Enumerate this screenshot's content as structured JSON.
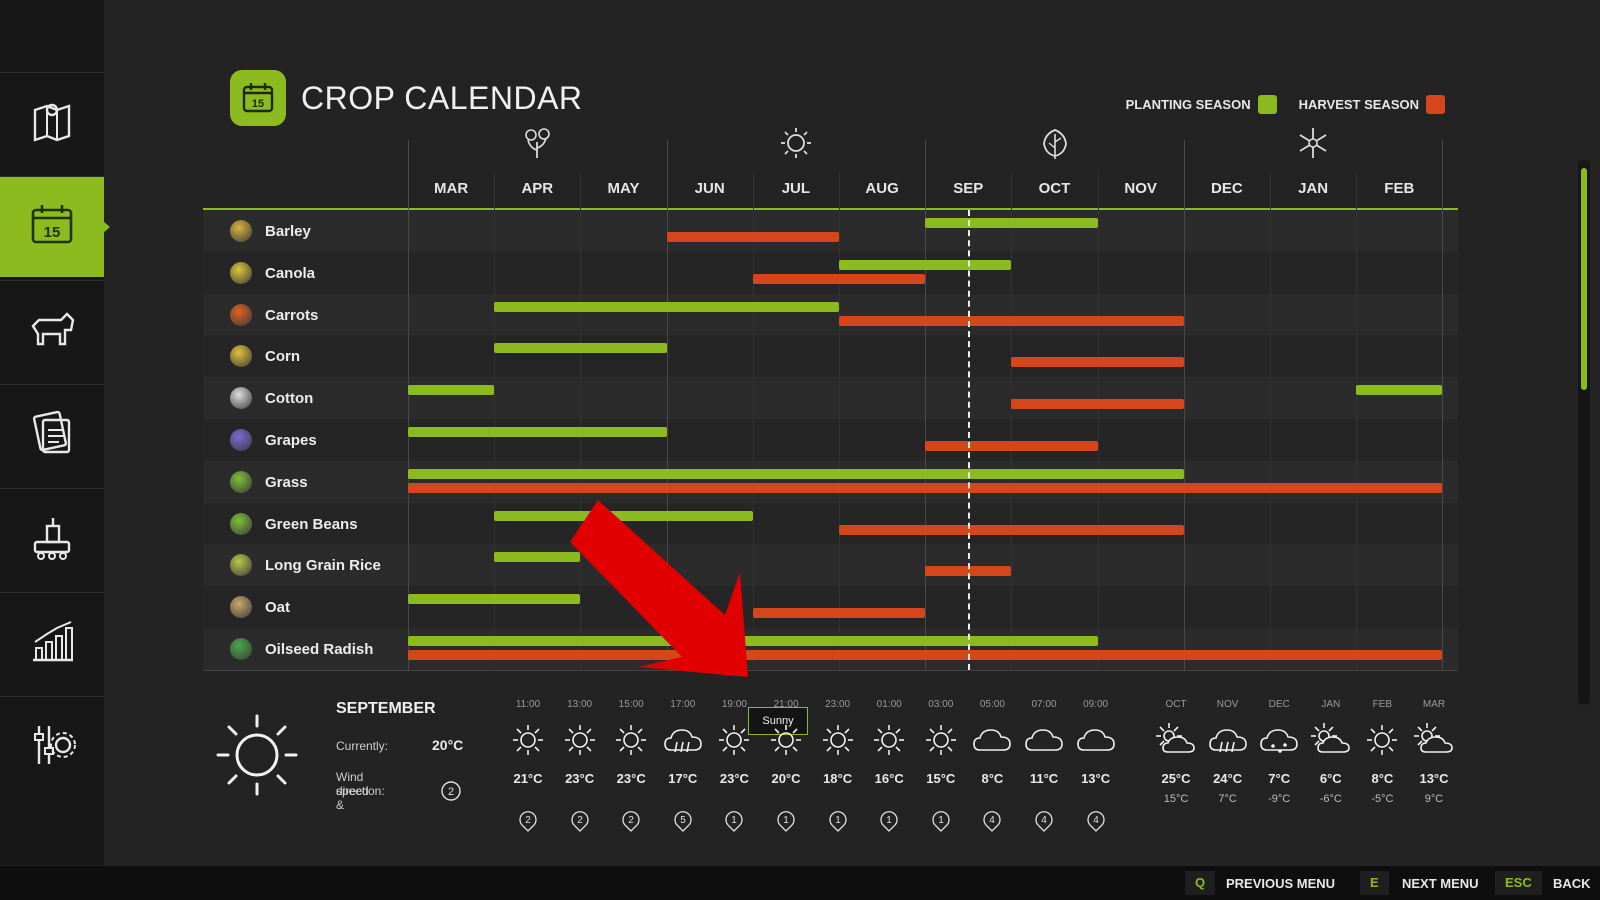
{
  "title": "CROP CALENDAR",
  "legend": {
    "planting_label": "PLANTING SEASON",
    "harvest_label": "HARVEST SEASON",
    "planting_color": "#8cbb1f",
    "harvest_color": "#d6461b"
  },
  "sidebar": {
    "items": [
      {
        "name": "map-icon",
        "active": false
      },
      {
        "name": "calendar-icon",
        "active": true
      },
      {
        "name": "cow-icon",
        "active": false
      },
      {
        "name": "contracts-icon",
        "active": false
      },
      {
        "name": "production-icon",
        "active": false
      },
      {
        "name": "statistics-icon",
        "active": false
      },
      {
        "name": "settings-icon",
        "active": false
      }
    ]
  },
  "months": [
    "MAR",
    "APR",
    "MAY",
    "JUN",
    "JUL",
    "AUG",
    "SEP",
    "OCT",
    "NOV",
    "DEC",
    "JAN",
    "FEB"
  ],
  "season_icons": [
    "spring-flower-icon",
    "summer-sun-icon",
    "autumn-leaf-icon",
    "winter-snowflake-icon"
  ],
  "current_month_index": 6.5,
  "crops": [
    {
      "name": "Barley",
      "icon": "barley-icon",
      "color": "#d9b33a",
      "planting": [
        [
          6,
          8
        ]
      ],
      "harvest": [
        [
          3,
          5
        ]
      ]
    },
    {
      "name": "Canola",
      "icon": "canola-icon",
      "color": "#d9c63a",
      "planting": [
        [
          5,
          7
        ]
      ],
      "harvest": [
        [
          4,
          6
        ]
      ]
    },
    {
      "name": "Carrots",
      "icon": "carrot-icon",
      "color": "#e0601f",
      "planting": [
        [
          1,
          5
        ]
      ],
      "harvest": [
        [
          5,
          9
        ]
      ]
    },
    {
      "name": "Corn",
      "icon": "corn-icon",
      "color": "#e0c23a",
      "planting": [
        [
          1,
          3
        ]
      ],
      "harvest": [
        [
          7,
          9
        ]
      ]
    },
    {
      "name": "Cotton",
      "icon": "cotton-icon",
      "color": "#dddddd",
      "planting": [
        [
          0,
          1
        ],
        [
          11,
          12
        ]
      ],
      "harvest": [
        [
          7,
          9
        ]
      ]
    },
    {
      "name": "Grapes",
      "icon": "grapes-icon",
      "color": "#7a6ad8",
      "planting": [
        [
          0,
          3
        ]
      ],
      "harvest": [
        [
          6,
          8
        ]
      ]
    },
    {
      "name": "Grass",
      "icon": "grass-icon",
      "color": "#7fbf3a",
      "planting": [
        [
          0,
          9
        ]
      ],
      "harvest": [
        [
          0,
          12
        ]
      ]
    },
    {
      "name": "Green Beans",
      "icon": "green-beans-icon",
      "color": "#7fbf3a",
      "planting": [
        [
          1,
          4
        ]
      ],
      "harvest": [
        [
          5,
          9
        ]
      ]
    },
    {
      "name": "Long Grain Rice",
      "icon": "rice-icon",
      "color": "#b8c84a",
      "planting": [
        [
          1,
          2
        ]
      ],
      "harvest": [
        [
          6,
          7
        ]
      ]
    },
    {
      "name": "Oat",
      "icon": "oat-icon",
      "color": "#c9a86a",
      "planting": [
        [
          0,
          2
        ]
      ],
      "harvest": [
        [
          4,
          6
        ]
      ]
    },
    {
      "name": "Oilseed Radish",
      "icon": "oilseed-radish-icon",
      "color": "#4aa84a",
      "planting": [
        [
          0,
          8
        ]
      ],
      "harvest": [
        [
          0,
          12
        ]
      ]
    }
  ],
  "weather": {
    "month": "SEPTEMBER",
    "currently_label": "Currently:",
    "currently_value": "20°C",
    "wind_label_1": "Wind speed &",
    "wind_label_2": "direction:",
    "wind_value": "2",
    "tooltip": "Sunny",
    "hourly": [
      {
        "time": "11:00",
        "temp": "21°C",
        "icon": "sunny",
        "wind": "2"
      },
      {
        "time": "13:00",
        "temp": "23°C",
        "icon": "sunny",
        "wind": "2"
      },
      {
        "time": "15:00",
        "temp": "23°C",
        "icon": "sunny",
        "wind": "2"
      },
      {
        "time": "17:00",
        "temp": "17°C",
        "icon": "rain",
        "wind": "5"
      },
      {
        "time": "19:00",
        "temp": "23°C",
        "icon": "sunny",
        "wind": "1"
      },
      {
        "time": "21:00",
        "temp": "20°C",
        "icon": "sunny",
        "wind": "1"
      },
      {
        "time": "23:00",
        "temp": "18°C",
        "icon": "sunny",
        "wind": "1"
      },
      {
        "time": "01:00",
        "temp": "16°C",
        "icon": "sunny",
        "wind": "1"
      },
      {
        "time": "03:00",
        "temp": "15°C",
        "icon": "sunny",
        "wind": "1"
      },
      {
        "time": "05:00",
        "temp": "8°C",
        "icon": "cloud",
        "wind": "4"
      },
      {
        "time": "07:00",
        "temp": "11°C",
        "icon": "cloud",
        "wind": "4"
      },
      {
        "time": "09:00",
        "temp": "13°C",
        "icon": "cloud",
        "wind": "4"
      }
    ],
    "monthly": [
      {
        "month": "OCT",
        "hi": "25°C",
        "lo": "15°C",
        "icon": "partly-cloudy"
      },
      {
        "month": "NOV",
        "hi": "24°C",
        "lo": "7°C",
        "icon": "rain"
      },
      {
        "month": "DEC",
        "hi": "7°C",
        "lo": "-9°C",
        "icon": "snow"
      },
      {
        "month": "JAN",
        "hi": "6°C",
        "lo": "-6°C",
        "icon": "partly-cloudy"
      },
      {
        "month": "FEB",
        "hi": "8°C",
        "lo": "-5°C",
        "icon": "sunny"
      },
      {
        "month": "MAR",
        "hi": "13°C",
        "lo": "9°C",
        "icon": "partly-cloudy"
      }
    ]
  },
  "footer": {
    "prev_key": "Q",
    "prev_label": "PREVIOUS MENU",
    "next_key": "E",
    "next_label": "NEXT MENU",
    "back_key": "ESC",
    "back_label": "BACK"
  }
}
